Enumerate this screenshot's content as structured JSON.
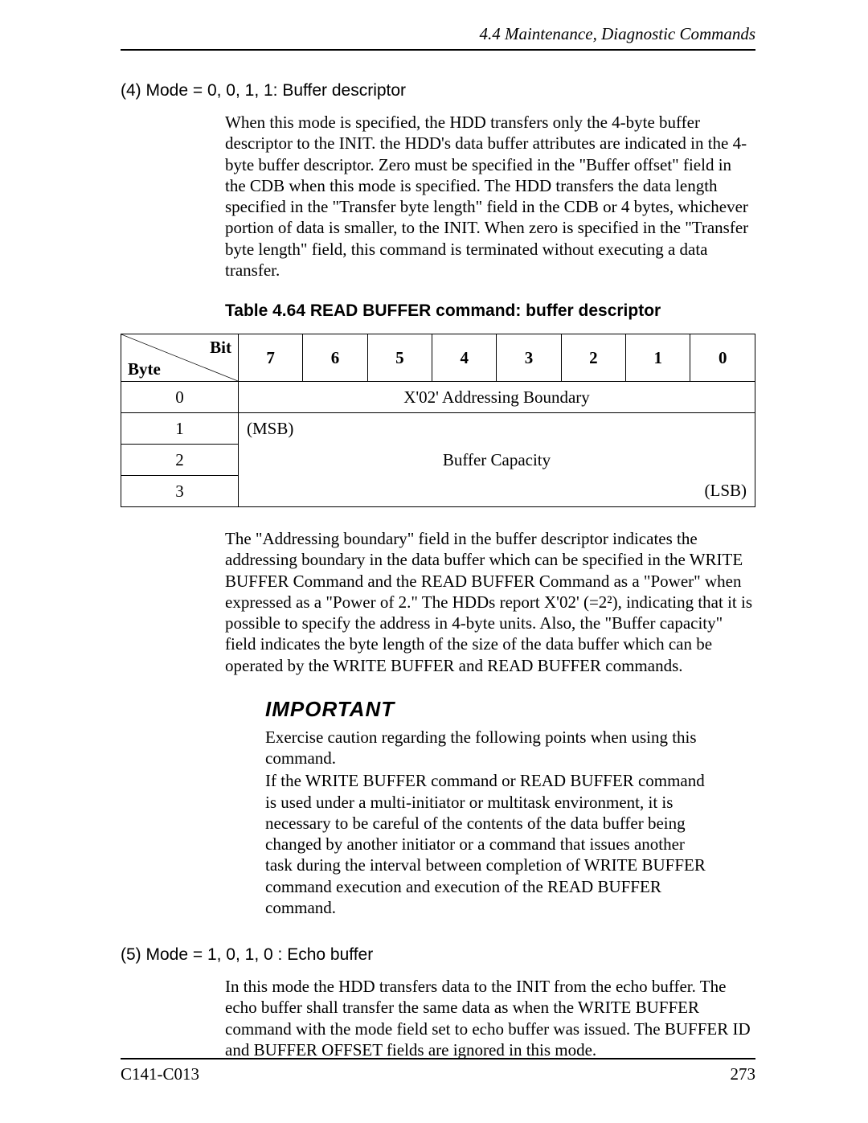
{
  "header": {
    "section": "4.4   Maintenance, Diagnostic Commands"
  },
  "sec4": {
    "title": "(4)  Mode = 0, 0, 1, 1:  Buffer descriptor",
    "para": "When this mode is specified, the HDD transfers only the 4-byte buffer descriptor to the INIT.  the HDD's data buffer attributes are indicated in the 4-byte buffer descriptor.  Zero must be specified in the \"Buffer offset\" field in the CDB when this mode is specified.  The HDD transfers the data length specified in the \"Transfer byte length\" field in the CDB or 4 bytes, whichever portion of data is smaller, to the INIT.  When zero is specified in the \"Transfer byte length\" field, this command is terminated without executing a data transfer."
  },
  "table": {
    "caption": "Table 4.64  READ BUFFER command: buffer descriptor",
    "corner_top": "Bit",
    "corner_bot": "Byte",
    "bits": [
      "7",
      "6",
      "5",
      "4",
      "3",
      "2",
      "1",
      "0"
    ],
    "byte_labels": [
      "0",
      "1",
      "2",
      "3"
    ],
    "row0": "X'02' Addressing Boundary",
    "row1_left": "(MSB)",
    "row2": "Buffer Capacity",
    "row3_right": "(LSB)"
  },
  "after_table": {
    "para": "The \"Addressing boundary\" field in the buffer descriptor indicates the addressing boundary in the data buffer which can be specified in the WRITE BUFFER Command and the READ BUFFER Command as a \"Power\" when expressed as a \"Power of 2.\"  The HDDs report X'02' (=2²), indicating that it is possible to specify the address in 4-byte units.  Also, the \"Buffer capacity\" field indicates the byte length of the size of the data buffer which can be operated by the WRITE BUFFER and READ BUFFER commands."
  },
  "important": {
    "label": "IMPORTANT",
    "p1": "Exercise caution regarding the following points when using this command.",
    "p2": "If the WRITE BUFFER command or READ BUFFER command is used under a multi-initiator or multitask environment, it is necessary to be careful of the contents of the data buffer being changed by another initiator or a command that issues another task during the interval between completion of WRITE BUFFER command execution and execution of the READ BUFFER command."
  },
  "sec5": {
    "title": "(5)  Mode = 1, 0, 1, 0 : Echo buffer",
    "para": "In this mode the HDD transfers data to the INIT from the echo buffer. The echo buffer shall transfer the same data as when the WRITE BUFFER command with the mode field set to echo buffer was issued. The BUFFER ID and BUFFER OFFSET fields are ignored in this mode."
  },
  "footer": {
    "doc": "C141-C013",
    "page": "273"
  }
}
